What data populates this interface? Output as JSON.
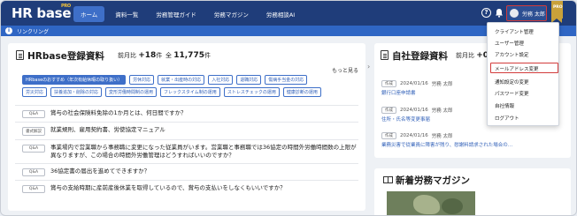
{
  "brand": {
    "logo": "HR base",
    "pro": "PRO"
  },
  "nav": [
    "ホーム",
    "資料一覧",
    "労務管理ガイド",
    "労務マガジン",
    "労務相談AI"
  ],
  "header": {
    "help": "?",
    "user_name": "労務 太郎",
    "ribbon": "PRO"
  },
  "linkbar": {
    "icon": "i",
    "label": "リンクリング"
  },
  "hr_docs": {
    "title": "HRbase登録資料",
    "prev_label": "前月比",
    "prev_value": "+18",
    "prev_unit": "件",
    "total_label": "全",
    "total_value": "11,775",
    "total_unit": "件",
    "more": "もっと見る"
  },
  "tags": [
    [
      "HRbaseのおすすめ（年次有給休暇の取り扱い）",
      "労休対応",
      "就業・出産時の対応",
      "入社対応",
      "退職対応",
      "傷病手当金の対応"
    ],
    [
      "労災対応",
      "扶養追加・削除の対応",
      "変形労働時間制の運用",
      "フレックスタイム制の運用",
      "ストレスチェックの運用",
      "健康診断の運用"
    ]
  ],
  "items": [
    {
      "badge": "Q&A",
      "text": "賞与の社会保険料免除の1か月とは、何日間ですか？"
    },
    {
      "badge": "書式解説",
      "text": "就業規則、雇用契約書、労使協定マニュアル"
    },
    {
      "badge": "Q&A",
      "text": "事業場内で営業職から事務職に変更になった従業員がいます。営業職と事務職では36協定の時間外労働時間数の上限が異なりますが、この場合の時間外労働管理はどうすればいいのですか？"
    },
    {
      "badge": "Q&A",
      "text": "36協定書の届出を進めてできますか？"
    },
    {
      "badge": "Q&A",
      "text": "賞与の支給時期に産前産後休業を取得しているので、賞与の支払いをしなくもいいですか？"
    }
  ],
  "own_docs": {
    "title": "自社登録資料",
    "prev_label": "前月比",
    "prev_value": "+0",
    "items": [
      {
        "badge": "作成",
        "date": "2024/01/16",
        "author": "労務 太郎",
        "title": "銀行口座申請書"
      },
      {
        "badge": "作成",
        "date": "2024/01/16",
        "author": "労務 太郎",
        "title": "住所・氏名等変更事届"
      },
      {
        "badge": "作成",
        "date": "2024/01/16",
        "author": "労務 太郎",
        "title": "業務災害で従業員に障害が残り、慰謝料請求された場合の…"
      }
    ]
  },
  "magazine": {
    "title": "新着労務マガジン"
  },
  "menu": [
    "クライアント管理",
    "ユーザー管理",
    "アカウント設定",
    "メールアドレス変更",
    "通知設定の変更",
    "パスワード変更",
    "自社情報",
    "ログアウト"
  ],
  "arrow": "›"
}
